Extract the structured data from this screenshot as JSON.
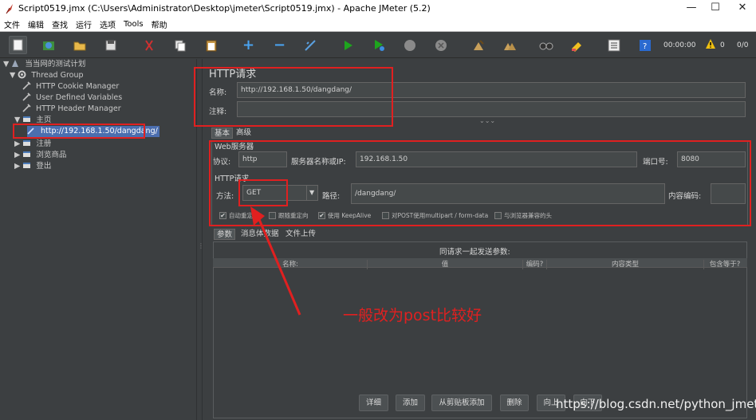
{
  "window": {
    "title": "Script0519.jmx (C:\\Users\\Administrator\\Desktop\\jmeter\\Script0519.jmx) - Apache JMeter (5.2)",
    "minimize": "—",
    "maximize": "☐",
    "close": "✕"
  },
  "menu": [
    "文件",
    "编辑",
    "查找",
    "运行",
    "选项",
    "Tools",
    "帮助"
  ],
  "toolbar": {
    "timer": "00:00:00",
    "warn_count": "0",
    "threads": "0/0"
  },
  "tree": {
    "plan": "当当网的测试计划",
    "thread_group": "Thread Group",
    "cookie": "HTTP Cookie Manager",
    "udv": "User Defined Variables",
    "header": "HTTP Header Manager",
    "home": "主页",
    "selected_sampler": "http://192.168.1.50/dangdang/",
    "register": "注册",
    "browse": "浏览商品",
    "logout": "登出"
  },
  "panel": {
    "title": "HTTP请求",
    "name_label": "名称:",
    "name_value": "http://192.168.1.50/dangdang/",
    "comment_label": "注释:",
    "comment_value": "",
    "tab_basic": "基本",
    "tab_advanced": "高级",
    "web_server": "Web服务器",
    "protocol_label": "协议:",
    "protocol_value": "http",
    "server_label": "服务器名称或IP:",
    "server_value": "192.168.1.50",
    "port_label": "端口号:",
    "port_value": "8080",
    "http_request": "HTTP请求",
    "method_label": "方法:",
    "method_value": "GET",
    "path_label": "路径:",
    "path_value": "/dangdang/",
    "encoding_label": "内容编码:",
    "encoding_value": "",
    "opt_redirect_auto": "自动重定向",
    "opt_follow_redirect": "跟随重定向",
    "opt_keepalive": "使用 KeepAlive",
    "opt_multipart": "对POST使用multipart / form-data",
    "opt_browser_headers": "与浏览器兼容的头",
    "tab_params": "参数",
    "tab_body": "消息体数据",
    "tab_files": "文件上传",
    "send_params": "同请求一起发送参数:",
    "columns": [
      "名称:",
      "值",
      "编码?",
      "内容类型",
      "包含等于?"
    ],
    "buttons": [
      "详细",
      "添加",
      "从剪贴板添加",
      "删除",
      "向上",
      "向下"
    ]
  },
  "annotation": {
    "text": "一般改为post比较好",
    "color": "#e02020"
  },
  "watermark": "https://blog.csdn.net/python_jmeter"
}
